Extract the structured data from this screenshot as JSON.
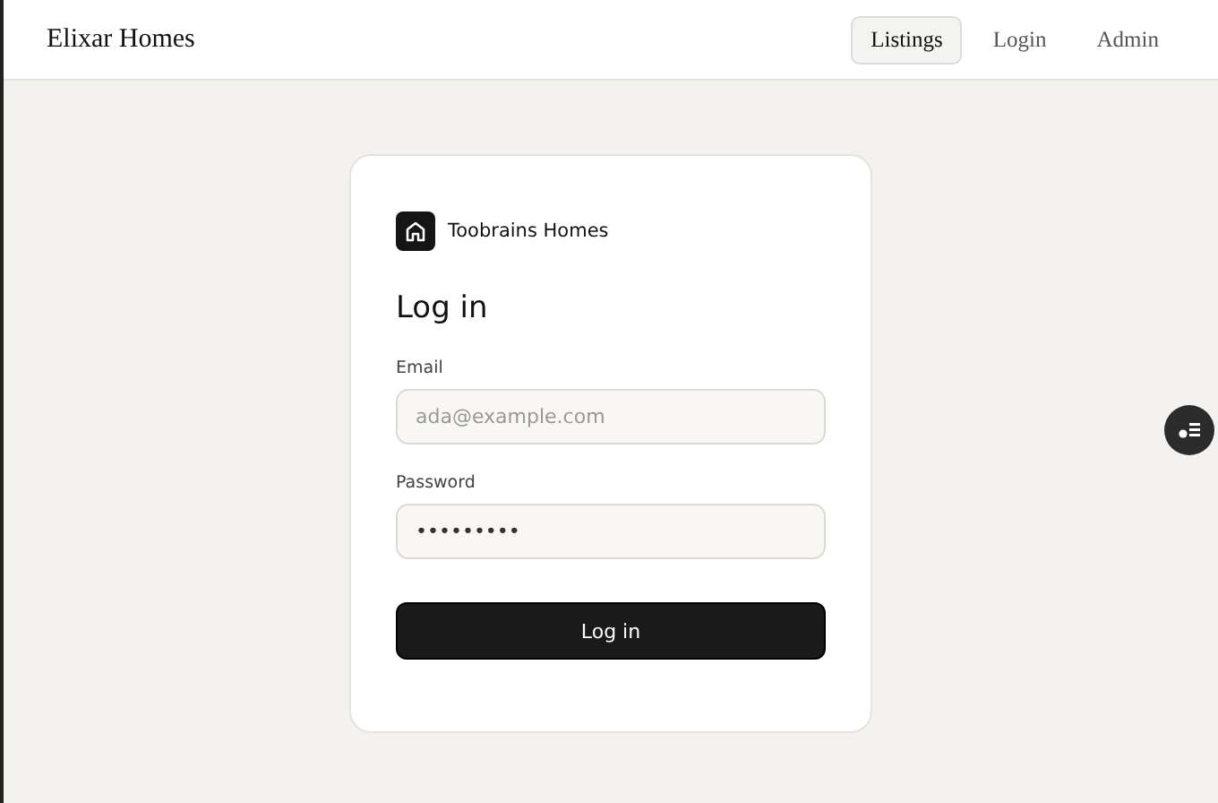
{
  "header": {
    "brand": "Elixar Homes",
    "nav": [
      {
        "label": "Listings",
        "selected": true
      },
      {
        "label": "Login",
        "selected": false
      },
      {
        "label": "Admin",
        "selected": false
      }
    ]
  },
  "card": {
    "org": "Toobrains Homes",
    "title": "Log in",
    "fields": [
      {
        "label": "Email",
        "placeholder": "ada@example.com"
      },
      {
        "label": "Password",
        "value": "•••••••••"
      }
    ],
    "submit": "Log in"
  }
}
